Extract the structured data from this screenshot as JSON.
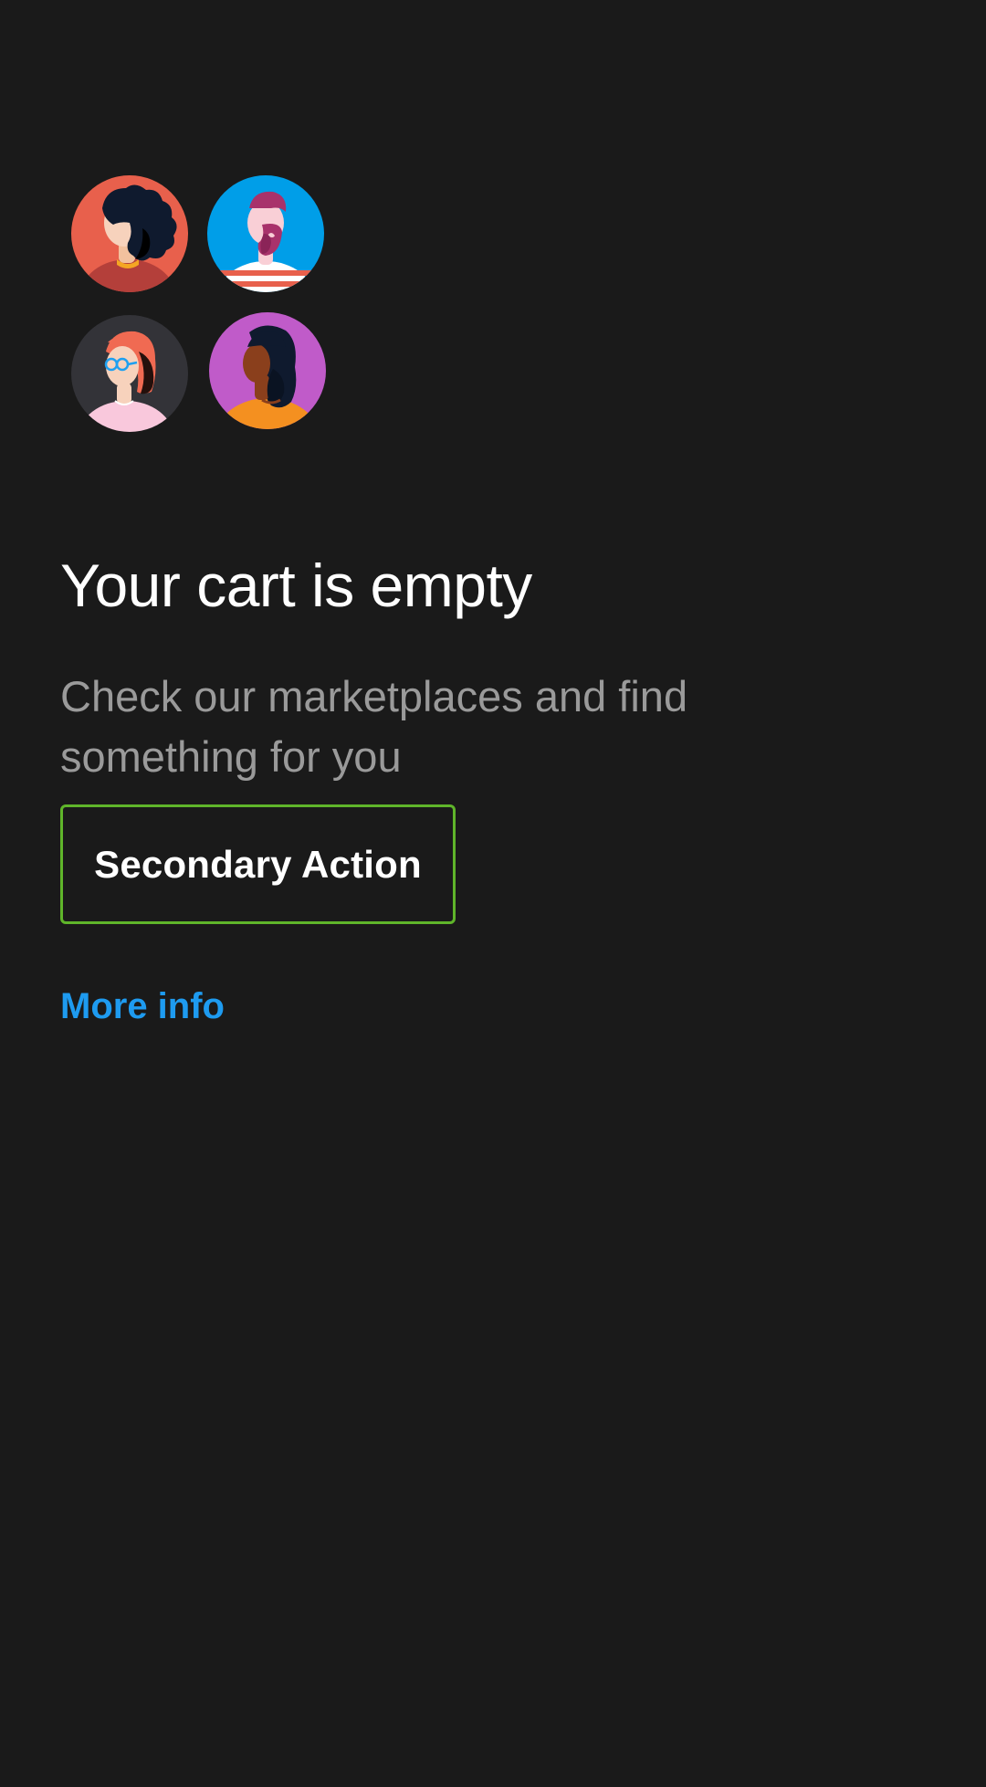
{
  "empty_state": {
    "avatars": [
      {
        "name": "avatar-curly-hair",
        "background": "#e8604c"
      },
      {
        "name": "avatar-bearded-man",
        "background": "#009ee8"
      },
      {
        "name": "avatar-woman-glasses",
        "background": "#333338"
      },
      {
        "name": "avatar-woman-long-hair",
        "background": "#c05bc9"
      }
    ],
    "title": "Your cart is empty",
    "description": "Check our marketplaces and find something for you",
    "secondary_action_label": "Secondary Action",
    "link_label": "More info"
  },
  "colors": {
    "background": "#1a1a1a",
    "title": "#ffffff",
    "description": "#9a9a9a",
    "button_border": "#5fb52a",
    "link": "#1e9bf0"
  }
}
